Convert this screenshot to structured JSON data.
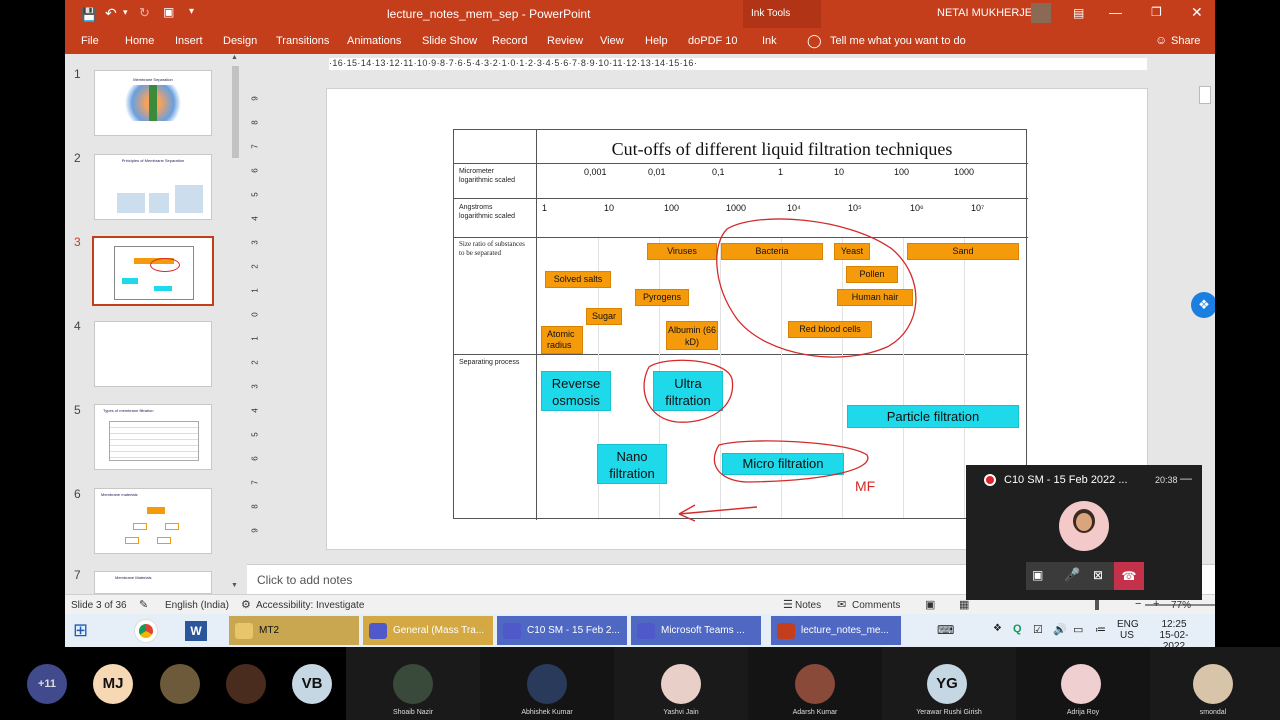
{
  "window": {
    "title": "lecture_notes_mem_sep  -  PowerPoint",
    "contextual_tab": "Ink Tools",
    "user": "NETAI MUKHERJEE"
  },
  "ribbon": {
    "tabs": [
      "File",
      "Home",
      "Insert",
      "Design",
      "Transitions",
      "Animations",
      "Slide Show",
      "Record",
      "Review",
      "View",
      "Help",
      "doPDF 10",
      "Ink"
    ],
    "tell_me": "Tell me what you want to do",
    "share": "Share"
  },
  "thumbnails": [
    {
      "num": "1",
      "title": "Membrane Separation"
    },
    {
      "num": "2",
      "title": "Principles of Membrane Separation"
    },
    {
      "num": "3",
      "title": ""
    },
    {
      "num": "4",
      "title": ""
    },
    {
      "num": "5",
      "title": "Types of membrane filtration"
    },
    {
      "num": "6",
      "title": "Membrane materials"
    },
    {
      "num": "7",
      "title": "Membrane Materials"
    }
  ],
  "ruler": {
    "h": "·16·15·14·13·12·11·10·9·8·7·6·5·4·3·2·1·0·1·2·3·4·5·6·7·8·9·10·11·12·13·14·15·16·",
    "v": [
      "9",
      "8",
      "7",
      "6",
      "5",
      "4",
      "3",
      "2",
      "1",
      "0",
      "1",
      "2",
      "3",
      "4",
      "5",
      "6",
      "7",
      "8",
      "9"
    ]
  },
  "slide": {
    "title": "Cut-offs of different liquid filtration techniques",
    "row_labels": {
      "micrometer": "Micrometer logarithmic scaled",
      "angstroms": "Angstroms logarithmic scaled",
      "size_ratio": "Size ratio of substances to be separated",
      "process": "Separating process"
    },
    "micrometer_values": [
      "0,001",
      "0,01",
      "0,1",
      "1",
      "10",
      "100",
      "1000"
    ],
    "angstrom_values": [
      "1",
      "10",
      "100",
      "1000",
      "10⁴",
      "10⁵",
      "10⁶",
      "10⁷"
    ],
    "substances": [
      "Viruses",
      "Bacteria",
      "Yeast",
      "Sand",
      "Solved salts",
      "Pollen",
      "Pyrogens",
      "Human hair",
      "Sugar",
      "Albumin (66 kD)",
      "Red blood cells",
      "Atomic radius"
    ],
    "processes": [
      "Reverse osmosis",
      "Ultra filtration",
      "Particle filtration",
      "Nano filtration",
      "Micro filtration"
    ],
    "annotation": "MF"
  },
  "notes_placeholder": "Click to add notes",
  "status": {
    "slide": "Slide 3 of 36",
    "language": "English (India)",
    "accessibility": "Accessibility: Investigate",
    "notes": "Notes",
    "comments": "Comments",
    "zoom": "77%"
  },
  "taskbar": {
    "apps": [
      "MT2",
      "General (Mass Tra...",
      "C10 SM - 15 Feb 2...",
      "Microsoft Teams ...",
      "lecture_notes_me..."
    ],
    "lang": "ENG",
    "region": "US",
    "time": "12:25",
    "date": "15-02-2022"
  },
  "teams_call": {
    "title": "C10 SM - 15 Feb 2022 ...",
    "duration": "20:38"
  },
  "participants": [
    {
      "initials": "+11",
      "name": ""
    },
    {
      "initials": "MJ",
      "name": ""
    },
    {
      "initials": "",
      "name": ""
    },
    {
      "initials": "",
      "name": ""
    },
    {
      "initials": "VB",
      "name": ""
    },
    {
      "initials": "",
      "name": "Shoaib Nazir"
    },
    {
      "initials": "",
      "name": "Abhishek Kumar"
    },
    {
      "initials": "",
      "name": "Yashvi Jain"
    },
    {
      "initials": "",
      "name": "Adarsh Kumar"
    },
    {
      "initials": "YG",
      "name": "Yerawar Rushi Girish"
    },
    {
      "initials": "",
      "name": "Adrija Roy"
    },
    {
      "initials": "",
      "name": "smondal"
    }
  ],
  "colors": {
    "accent": "#c43e1c",
    "orange_box": "#f59a0b",
    "cyan_box": "#1ed9e9",
    "ink": "#d42a2a"
  }
}
